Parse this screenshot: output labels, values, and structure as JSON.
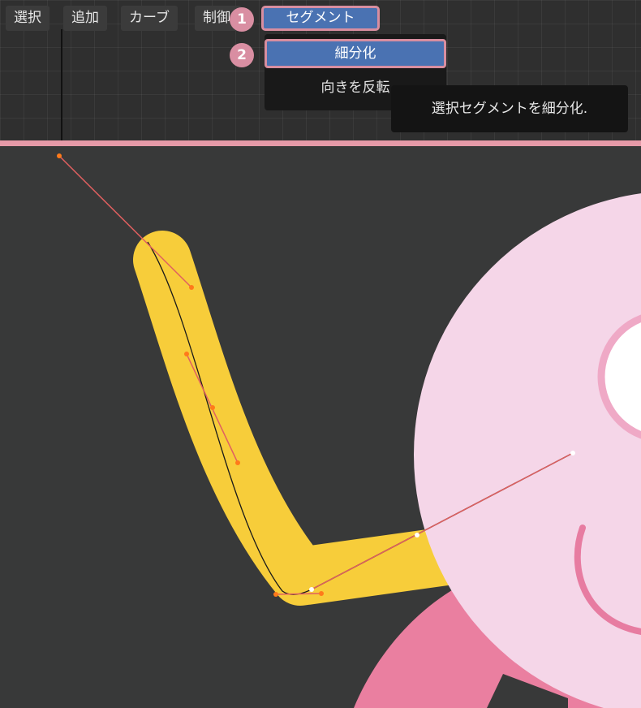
{
  "menubar": {
    "items": [
      {
        "label": "選択"
      },
      {
        "label": "追加"
      },
      {
        "label": "カーブ"
      },
      {
        "label": "制御"
      },
      {
        "label": "セグメント"
      }
    ]
  },
  "dropdown": {
    "items": [
      {
        "label": "細分化"
      },
      {
        "label": "向きを反転"
      }
    ]
  },
  "tooltip": {
    "text": "選択セグメントを細分化."
  },
  "badges": [
    "1",
    "2"
  ],
  "colors": {
    "accent": "#4a72b2",
    "highlight_border": "#d88ea0",
    "stroke_yellow": "#f7cd3a",
    "body_pink": "#f5d6e8",
    "dark_pink": "#ea7fa0",
    "handle_red": "#e06060"
  }
}
